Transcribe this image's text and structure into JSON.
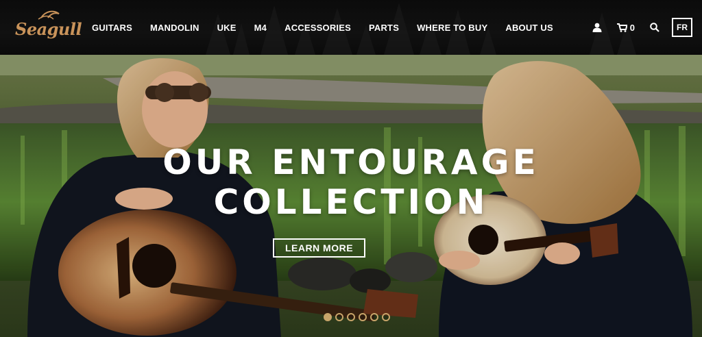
{
  "brand": {
    "logo_text": "Seagull",
    "logo_color": "#c9935a"
  },
  "nav": {
    "items": [
      {
        "label": "GUITARS"
      },
      {
        "label": "MANDOLIN"
      },
      {
        "label": "UKE"
      },
      {
        "label": "M4"
      },
      {
        "label": "ACCESSORIES"
      },
      {
        "label": "PARTS"
      },
      {
        "label": "WHERE TO BUY"
      },
      {
        "label": "ABOUT US"
      }
    ]
  },
  "utilities": {
    "account_icon": "user-icon",
    "cart_icon": "cart-icon",
    "cart_count": "0",
    "search_icon": "search-icon",
    "language_label": "FR"
  },
  "hero": {
    "title_line1": "OUR ENTOURAGE",
    "title_line2": "COLLECTION",
    "cta_label": "LEARN MORE",
    "slide_count": 6,
    "active_slide": 1
  },
  "colors": {
    "accent": "#c8a56a",
    "header_bg": "#0b0b0b",
    "text": "#ffffff"
  }
}
